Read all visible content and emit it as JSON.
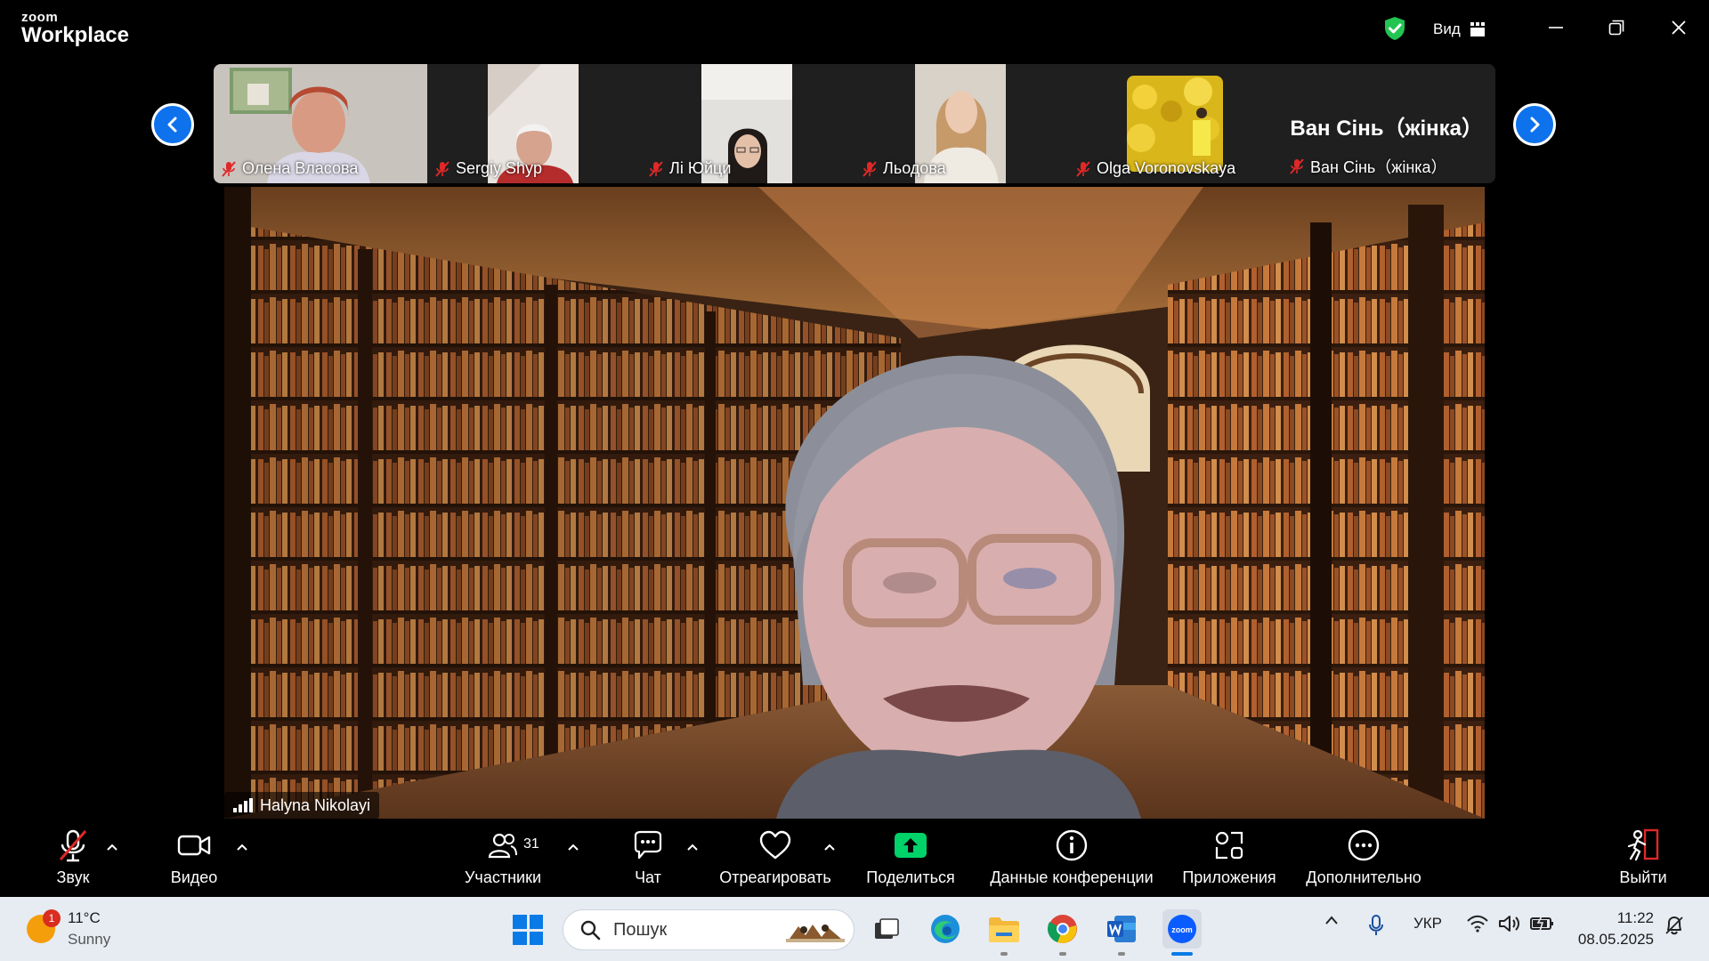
{
  "window": {
    "brand_small": "zoom",
    "brand_big": "Workplace",
    "view_label": "Вид"
  },
  "thumbnails": [
    {
      "name": "Олена Власова"
    },
    {
      "name": "Sergiy Shyp"
    },
    {
      "name": "Лі Юйци"
    },
    {
      "name": "Льодова"
    },
    {
      "name": "Olga Voronovskaya"
    },
    {
      "name": "Ван Сінь（жінка）",
      "big_name": "Ван Сінь（жінка）"
    }
  ],
  "main_speaker": {
    "name": "Halyna Nikolayi"
  },
  "toolbar": {
    "audio_label": "Звук",
    "video_label": "Видео",
    "participants_label": "Участники",
    "participants_count": "31",
    "chat_label": "Чат",
    "react_label": "Отреагировать",
    "share_label": "Поделиться",
    "info_label": "Данные конференции",
    "apps_label": "Приложения",
    "more_label": "Дополнительно",
    "leave_label": "Выйти"
  },
  "taskbar": {
    "weather_temp": "11°C",
    "weather_desc": "Sunny",
    "weather_badge": "1",
    "search_placeholder": "Пошук",
    "language": "УКР",
    "time": "11:22",
    "date": "08.05.2025"
  },
  "colors": {
    "accent": "#0e72ed",
    "share_green": "#00d26a",
    "mute_red": "#e02828",
    "shield_green": "#23c552"
  }
}
